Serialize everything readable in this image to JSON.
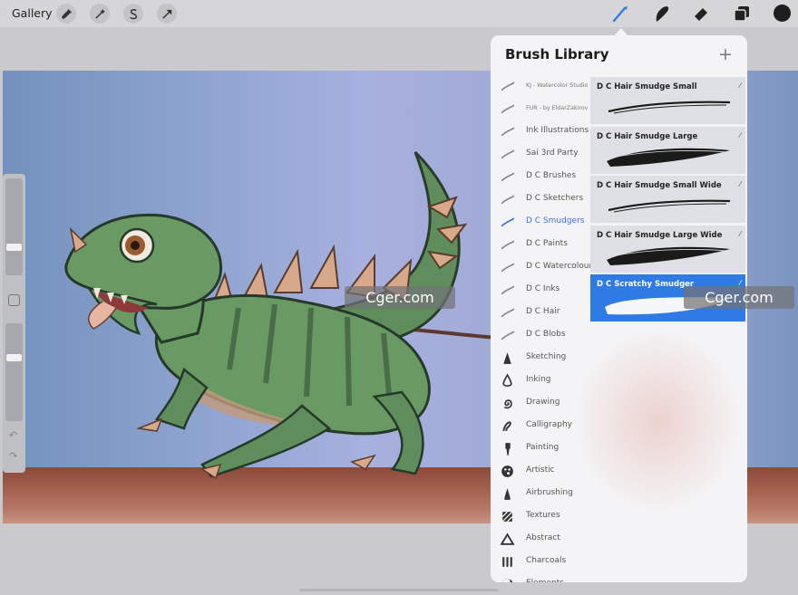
{
  "toolbar": {
    "gallery_label": "Gallery",
    "left_tools": [
      "wrench-icon",
      "magic-wand-icon",
      "selection-s-icon",
      "transform-arrow-icon"
    ],
    "right_tools": [
      "brush-icon",
      "smudge-icon",
      "eraser-icon",
      "layers-icon"
    ],
    "active_tool": "brush-icon",
    "current_color": "#1e1e1e"
  },
  "brush_library": {
    "title": "Brush Library",
    "add_button": "+",
    "sets": [
      {
        "label": "KJ - Watercolor Studio",
        "icon": "stroke-icon",
        "small": true
      },
      {
        "label": "FUR - by EldarZakirov",
        "icon": "stroke-icon",
        "small": true
      },
      {
        "label": "Ink Illustrations",
        "icon": "stroke-icon"
      },
      {
        "label": "Sai 3rd Party",
        "icon": "stroke-icon"
      },
      {
        "label": "D C Brushes",
        "icon": "stroke-icon"
      },
      {
        "label": "D C Sketchers",
        "icon": "stroke-icon"
      },
      {
        "label": "D C Smudgers",
        "icon": "stroke-icon",
        "active": true
      },
      {
        "label": "D C Paints",
        "icon": "stroke-icon"
      },
      {
        "label": "D C Watercolour",
        "icon": "stroke-icon"
      },
      {
        "label": "D C Inks",
        "icon": "stroke-icon"
      },
      {
        "label": "D C Hair",
        "icon": "stroke-icon"
      },
      {
        "label": "D C Blobs",
        "icon": "stroke-icon"
      },
      {
        "label": "Sketching",
        "icon": "pencil-tip-icon"
      },
      {
        "label": "Inking",
        "icon": "ink-drop-icon"
      },
      {
        "label": "Drawing",
        "icon": "spiral-icon"
      },
      {
        "label": "Calligraphy",
        "icon": "calligraphy-icon"
      },
      {
        "label": "Painting",
        "icon": "paintbrush-icon"
      },
      {
        "label": "Artistic",
        "icon": "palette-icon"
      },
      {
        "label": "Airbrushing",
        "icon": "airbrush-icon"
      },
      {
        "label": "Textures",
        "icon": "texture-icon"
      },
      {
        "label": "Abstract",
        "icon": "triangle-icon"
      },
      {
        "label": "Charcoals",
        "icon": "charcoal-icon"
      },
      {
        "label": "Elements",
        "icon": "yin-yang-icon"
      }
    ],
    "brushes": [
      {
        "name": "D C Hair Smudge Small",
        "weight": "thin"
      },
      {
        "name": "D C Hair Smudge Large",
        "weight": "thick"
      },
      {
        "name": "D C Hair Smudge Small Wide",
        "weight": "thin"
      },
      {
        "name": "D C Hair Smudge Large Wide",
        "weight": "thick"
      },
      {
        "name": "D C Scratchy Smudger",
        "weight": "white",
        "selected": true
      }
    ]
  },
  "watermark": {
    "text": "Cger.com"
  }
}
